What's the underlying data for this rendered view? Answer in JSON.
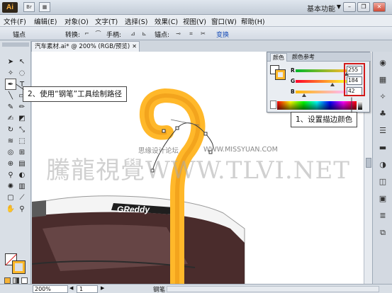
{
  "app": {
    "logo": "Ai",
    "workspace": "基本功能"
  },
  "menu": [
    "文件(F)",
    "编辑(E)",
    "对象(O)",
    "文字(T)",
    "选择(S)",
    "效果(C)",
    "视图(V)",
    "窗口(W)",
    "帮助(H)"
  ],
  "control": {
    "anchor_label": "锚点",
    "convert_label": "转换:",
    "handle_label": "手柄:",
    "anchors_label": "锚点:",
    "convert_link": "变换"
  },
  "document": {
    "tab_title": "汽车素材.ai* @ 200% (RGB/预览)"
  },
  "color_panel": {
    "tabs": [
      "颜色",
      "颜色参考"
    ],
    "channels": [
      {
        "label": "R",
        "value": "255",
        "fraction": 1.0
      },
      {
        "label": "G",
        "value": "184",
        "fraction": 0.72
      },
      {
        "label": "B",
        "value": "42",
        "fraction": 0.16
      }
    ],
    "stroke_color": "#FFB82A"
  },
  "callouts": {
    "step1": "1、设置描边颜色",
    "step2": "2、使用“钢笔”工具绘制路径"
  },
  "watermarks": {
    "main": "騰龍視覺WWW.TLVI.NET",
    "small_left": "思缘设计论坛",
    "small_right": "WWW.MISSYUAN.COM"
  },
  "artwork": {
    "brand": "GReddy"
  },
  "status": {
    "zoom": "200%",
    "page": "1",
    "tool": "钢笔"
  }
}
